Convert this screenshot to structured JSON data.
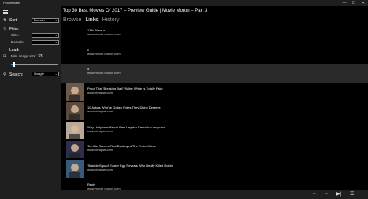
{
  "window": {
    "title": "PictureMeet",
    "min": "—",
    "max": "☐",
    "close": "✕"
  },
  "sidebar": {
    "sort_label": "Sort:",
    "sort_value": "Domain",
    "filter_label": "Filter:",
    "size_label": "Size:",
    "size_value": "",
    "domain_label": "Domain:",
    "domain_value": "",
    "load_label": "Load:",
    "min_image_label": "Min. image size:",
    "min_image_value": "33",
    "min_image_fraction": 0.06,
    "search_label": "Search:",
    "search_value": "Google"
  },
  "main": {
    "title": "Top 30 Best Movies Of 2017 – Preview Guide | Movie Moron – Part 3",
    "tabs": [
      {
        "label": "Browse"
      },
      {
        "label": "Links"
      },
      {
        "label": "History"
      }
    ],
    "items": [
      {
        "title": "13th Place »",
        "url": "www.movie-moron.com",
        "thumb": "",
        "selected": false
      },
      {
        "title": "2",
        "url": "www.movie-moron.com",
        "thumb": "",
        "selected": false
      },
      {
        "title": "5",
        "url": "www.movie-moron.com",
        "thumb": "",
        "selected": true
      },
      {
        "title": "Proof That 'Breaking Bad' Walter White Is Totally Fake",
        "url": "www.cinapse.com",
        "thumb": "person-a",
        "selected": false
      },
      {
        "title": "10 Actors Who've Gotten Roles They Didn't Deserve",
        "url": "www.cinapse.com",
        "thumb": "person-b",
        "selected": false
      },
      {
        "title": "Why Hollywood Won't Cast Hayden Panettiere Anymore",
        "url": "www.cinapse.com",
        "thumb": "person-c",
        "selected": false
      },
      {
        "title": "Terrible Scenes That Destroyed The Entire Movie",
        "url": "www.cinapse.com",
        "thumb": "person-d",
        "selected": false
      },
      {
        "title": "'Suicide Squad' Easter Egg Reveals Who Really Killed Robin",
        "url": "www.cinapse.com",
        "thumb": "person-e",
        "selected": false
      },
      {
        "title": "Reply",
        "url": "www.movie-moron.com",
        "thumb": "",
        "selected": false
      }
    ]
  },
  "bottombar": {
    "back": "←",
    "forward": "→",
    "skip": "▶|",
    "list": "☰",
    "more": "···"
  },
  "colors": {
    "accent": "#3b8fd8",
    "pane": "#1f1f1f",
    "selected_row": "#2a2a2a"
  }
}
